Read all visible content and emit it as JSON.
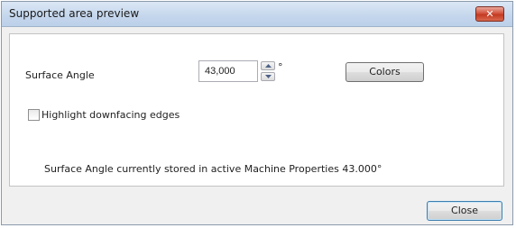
{
  "window": {
    "title": "Supported area preview",
    "close_glyph": "✕"
  },
  "surface_angle": {
    "label": "Surface Angle",
    "value": "43,000",
    "unit": "°"
  },
  "colors_button": {
    "label": "Colors"
  },
  "highlight": {
    "label": "Highlight downfacing edges",
    "checked": false
  },
  "info_text": "Surface Angle currently stored in active Machine Properties 43.000°",
  "close_button": {
    "label": "Close"
  },
  "icons": {
    "spin_up": "arrow-up-icon",
    "spin_down": "arrow-down-icon",
    "title_close": "close-icon"
  }
}
